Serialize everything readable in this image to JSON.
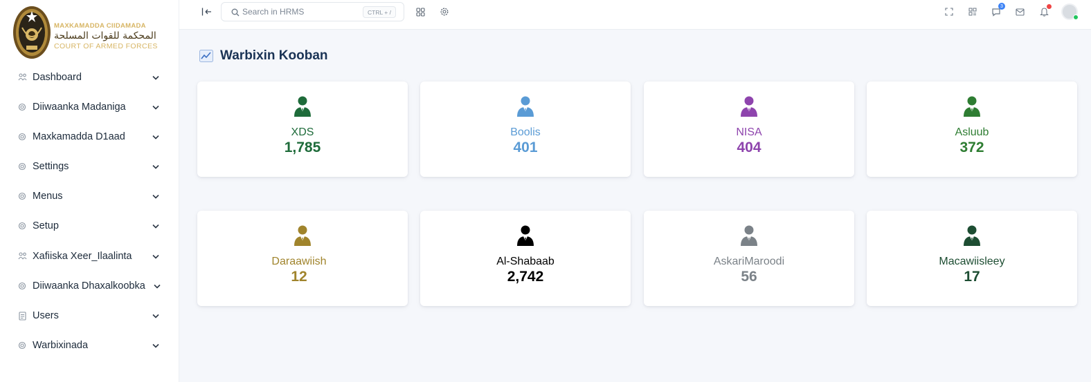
{
  "brand": {
    "line1": "MAXKAMADDA CIIDAMADA",
    "line2": "المحكمة للقوات المسلحة",
    "line3": "COURT OF ARMED FORCES"
  },
  "sidebar": {
    "items": [
      {
        "label": "Dashboard",
        "icon": "people-icon"
      },
      {
        "label": "Diiwaanka Madaniga",
        "icon": "gear-icon"
      },
      {
        "label": "Maxkamadda D1aad",
        "icon": "gear-icon"
      },
      {
        "label": "Settings",
        "icon": "gear-icon"
      },
      {
        "label": "Menus",
        "icon": "gear-icon"
      },
      {
        "label": "Setup",
        "icon": "gear-icon"
      },
      {
        "label": "Xafiiska Xeer_Ilaalinta",
        "icon": "people-icon"
      },
      {
        "label": "Diiwaanka Dhaxalkoobka",
        "icon": "gear-icon"
      },
      {
        "label": "Users",
        "icon": "document-icon"
      },
      {
        "label": "Warbixinada",
        "icon": "gear-icon"
      }
    ]
  },
  "topbar": {
    "search_placeholder": "Search in HRMS",
    "shortcut": "CTRL + /",
    "notification_count": "3"
  },
  "page": {
    "title": "Warbixin Kooban"
  },
  "cards": [
    {
      "label": "XDS",
      "value": "1,785",
      "color": "#1e6b3a"
    },
    {
      "label": "Boolis",
      "value": "401",
      "color": "#5a9bd5"
    },
    {
      "label": "NISA",
      "value": "404",
      "color": "#8e44ad"
    },
    {
      "label": "Asluub",
      "value": "372",
      "color": "#2e7d32"
    },
    {
      "label": "Daraawiish",
      "value": "12",
      "color": "#a0842c"
    },
    {
      "label": "Al-Shabaab",
      "value": "2,742",
      "color": "#000000"
    },
    {
      "label": "AskariMaroodi",
      "value": "56",
      "color": "#7b8288"
    },
    {
      "label": "Macawiisleey",
      "value": "17",
      "color": "#1d4d32"
    }
  ]
}
